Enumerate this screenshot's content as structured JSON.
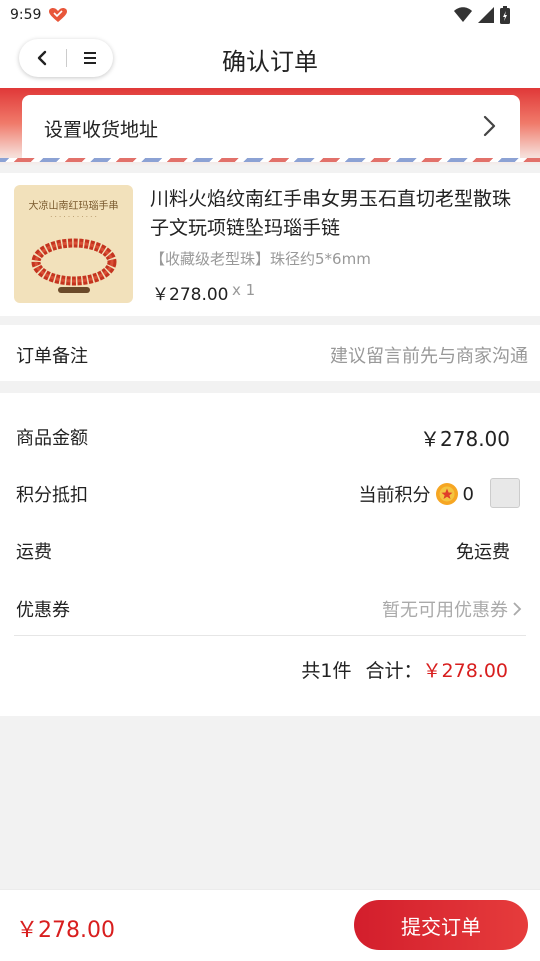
{
  "status": {
    "time": "9:59",
    "app_icon": "heart-app-icon",
    "icons": [
      "wifi-icon",
      "signal-icon",
      "battery-icon"
    ]
  },
  "nav": {
    "title": "确认订单",
    "back_icon": "chevron-left-icon",
    "menu_icon": "menu-icon"
  },
  "address": {
    "label": "设置收货地址"
  },
  "product": {
    "name": "川料火焰纹南红手串女男玉石直切老型散珠子文玩项链坠玛瑙手链",
    "spec": "【收藏级老型珠】珠径约5*6mm",
    "price": "￥278.00",
    "qty": "x 1",
    "thumb_title": "大凉山南红玛瑙手串"
  },
  "remark": {
    "label": "订单备注",
    "placeholder": "建议留言前先与商家沟通"
  },
  "summary": {
    "goods_label": "商品金额",
    "goods_value": "￥278.00",
    "points_label": "积分抵扣",
    "points_current_label": "当前积分",
    "points_value": "0",
    "shipping_label": "运费",
    "shipping_value": "免运费",
    "coupon_label": "优惠券",
    "coupon_value": "暂无可用优惠券",
    "count_text": "共1件",
    "total_label": "合计：",
    "total_value": "￥278.00"
  },
  "bottom": {
    "price": "￥278.00",
    "submit_label": "提交订单"
  },
  "colors": {
    "accent": "#d81e1e",
    "header_red": "#e03838"
  }
}
